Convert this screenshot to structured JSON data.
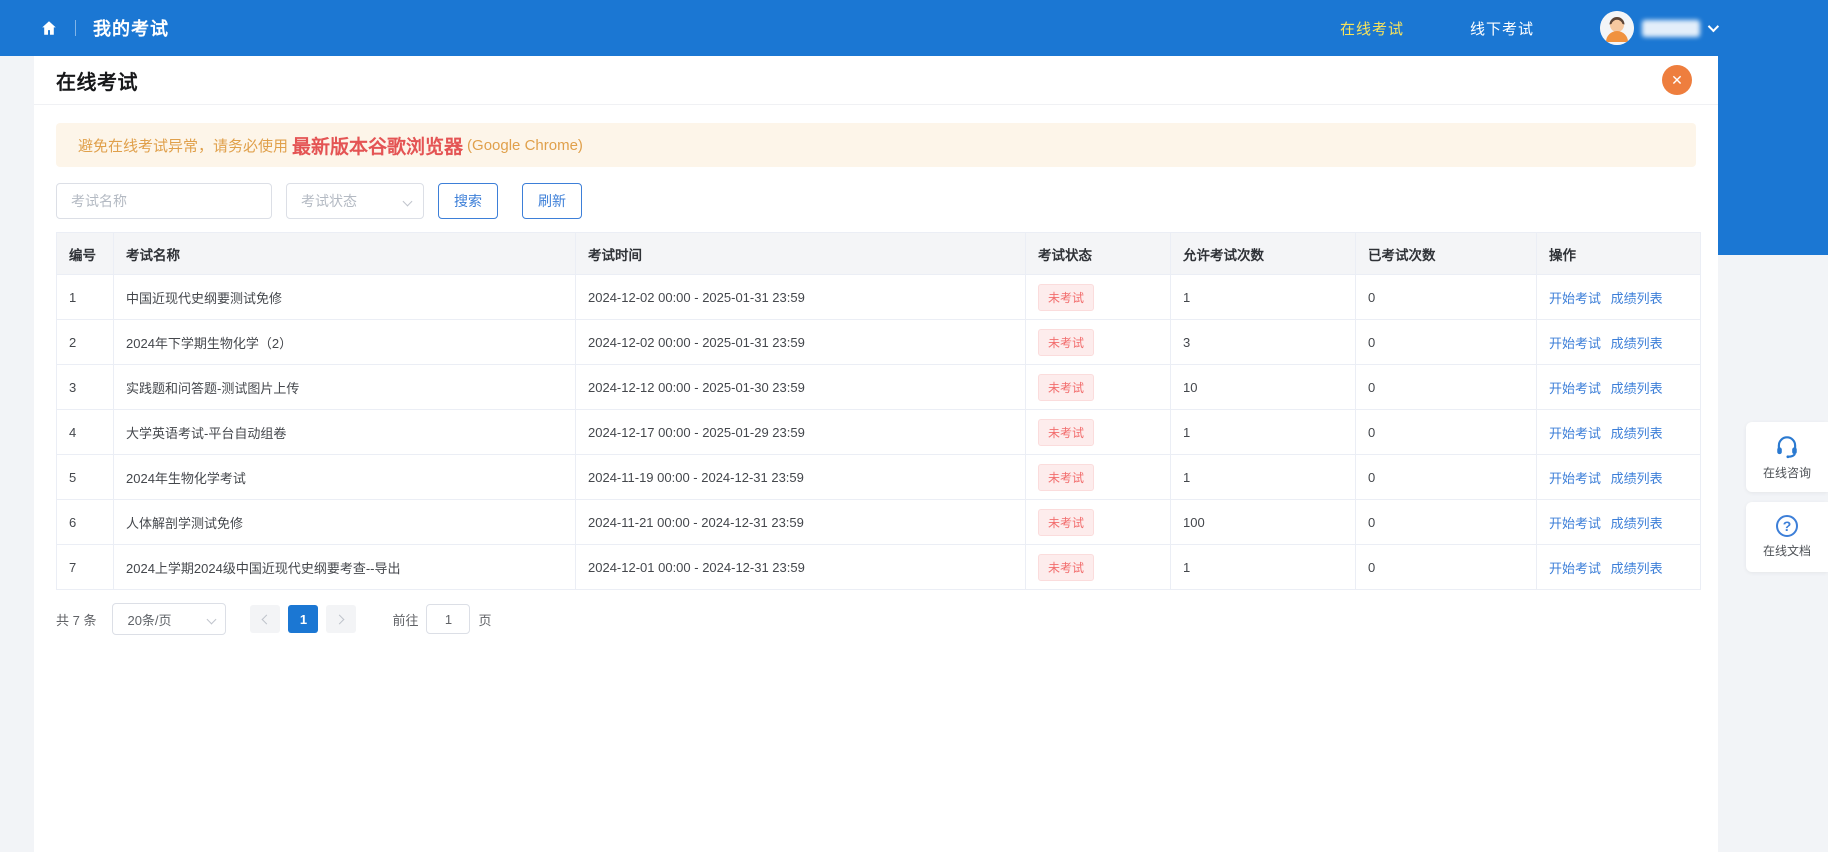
{
  "header": {
    "breadcrumb": "我的考试",
    "nav": [
      {
        "label": "在线考试",
        "active": true
      },
      {
        "label": "线下考试",
        "active": false
      }
    ]
  },
  "page": {
    "title": "在线考试",
    "close_symbol": "✕"
  },
  "banner": {
    "prefix": "避免在线考试异常，请务必使用",
    "highlight": "最新版本谷歌浏览器",
    "suffix": "(Google Chrome)"
  },
  "filters": {
    "name_placeholder": "考试名称",
    "status_placeholder": "考试状态",
    "search_label": "搜索",
    "refresh_label": "刷新"
  },
  "table": {
    "columns": [
      "编号",
      "考试名称",
      "考试时间",
      "考试状态",
      "允许考试次数",
      "已考试次数",
      "操作"
    ],
    "rows": [
      {
        "no": "1",
        "name": "中国近现代史纲要测试免修",
        "time": "2024-12-02 00:00 - 2025-01-31 23:59",
        "status": "未考试",
        "allowed": "1",
        "taken": "0",
        "actions": [
          "开始考试",
          "成绩列表"
        ]
      },
      {
        "no": "2",
        "name": "2024年下学期生物化学（2）",
        "time": "2024-12-02 00:00 - 2025-01-31 23:59",
        "status": "未考试",
        "allowed": "3",
        "taken": "0",
        "actions": [
          "开始考试",
          "成绩列表"
        ]
      },
      {
        "no": "3",
        "name": "实践题和问答题-测试图片上传",
        "time": "2024-12-12 00:00 - 2025-01-30 23:59",
        "status": "未考试",
        "allowed": "10",
        "taken": "0",
        "actions": [
          "开始考试",
          "成绩列表"
        ]
      },
      {
        "no": "4",
        "name": "大学英语考试-平台自动组卷",
        "time": "2024-12-17 00:00 - 2025-01-29 23:59",
        "status": "未考试",
        "allowed": "1",
        "taken": "0",
        "actions": [
          "开始考试",
          "成绩列表"
        ]
      },
      {
        "no": "5",
        "name": "2024年生物化学考试",
        "time": "2024-11-19 00:00 - 2024-12-31 23:59",
        "status": "未考试",
        "allowed": "1",
        "taken": "0",
        "actions": [
          "开始考试",
          "成绩列表"
        ]
      },
      {
        "no": "6",
        "name": "人体解剖学测试免修",
        "time": "2024-11-21 00:00 - 2024-12-31 23:59",
        "status": "未考试",
        "allowed": "100",
        "taken": "0",
        "actions": [
          "开始考试",
          "成绩列表"
        ]
      },
      {
        "no": "7",
        "name": "2024上学期2024级中国近现代史纲要考查--导出",
        "time": "2024-12-01 00:00 - 2024-12-31 23:59",
        "status": "未考试",
        "allowed": "1",
        "taken": "0",
        "actions": [
          "开始考试",
          "成绩列表"
        ]
      }
    ]
  },
  "pagination": {
    "total": "共 7 条",
    "page_size": "20条/页",
    "current_page": "1",
    "goto_label": "前往",
    "goto_value": "1",
    "page_suffix": "页"
  },
  "floating": [
    {
      "label": "在线咨询"
    },
    {
      "label": "在线文档"
    }
  ],
  "colors": {
    "primary": "#1b77d3",
    "accent-yellow": "#f7e35c",
    "warning-bg": "#fdf5e9",
    "warning-text": "#e0a04b",
    "warning-highlight": "#e45454",
    "link-blue": "#3d7fd8",
    "badge-bg": "#fdecec",
    "badge-text": "#f26d6d",
    "close-orange": "#ee7e3e",
    "page-bg": "#f2f4f7",
    "table-border": "#ebeef5"
  }
}
